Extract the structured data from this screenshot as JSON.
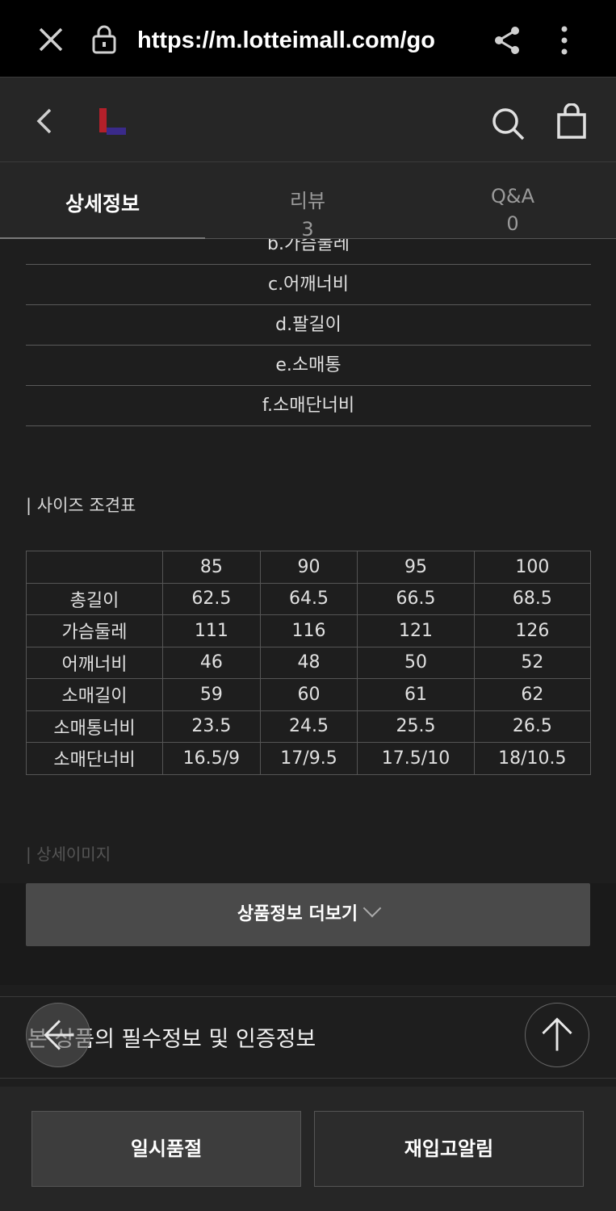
{
  "browser": {
    "url": "https://m.lotteimall.com/go",
    "icons": [
      "close-icon",
      "lock-icon",
      "share-icon",
      "more-vert-icon"
    ]
  },
  "header": {
    "icons": [
      "back-icon",
      "logo",
      "search-icon",
      "bag-icon"
    ],
    "logo_colors": [
      "#b3202a",
      "#3a2a8a"
    ]
  },
  "tabs": [
    {
      "label": "상세정보",
      "count": ""
    },
    {
      "label": "리뷰",
      "count": "3"
    },
    {
      "label": "Q&A",
      "count": "0"
    }
  ],
  "legend": [
    "b.가슴둘레",
    "c.어깨너비",
    "d.팔길이",
    "e.소매통",
    "f.소매단너비"
  ],
  "size_section": {
    "title": "| 사이즈 조견표",
    "columns": [
      "",
      "85",
      "90",
      "95",
      "100"
    ],
    "rows": [
      [
        "총길이",
        "62.5",
        "64.5",
        "66.5",
        "68.5"
      ],
      [
        "가슴둘레",
        "111",
        "116",
        "121",
        "126"
      ],
      [
        "어깨너비",
        "46",
        "48",
        "50",
        "52"
      ],
      [
        "소매길이",
        "59",
        "60",
        "61",
        "62"
      ],
      [
        "소매통너비",
        "23.5",
        "24.5",
        "25.5",
        "26.5"
      ],
      [
        "소매단너비",
        "16.5/9",
        "17/9.5",
        "17.5/10",
        "18/10.5"
      ]
    ]
  },
  "detail_image_title": "| 상세이미지",
  "more_button": "상품정보 더보기",
  "info_row": "본 상품의 필수정보 및 인증정보",
  "bottom": {
    "left_button": "일시품절",
    "right_button": "재입고알림"
  }
}
